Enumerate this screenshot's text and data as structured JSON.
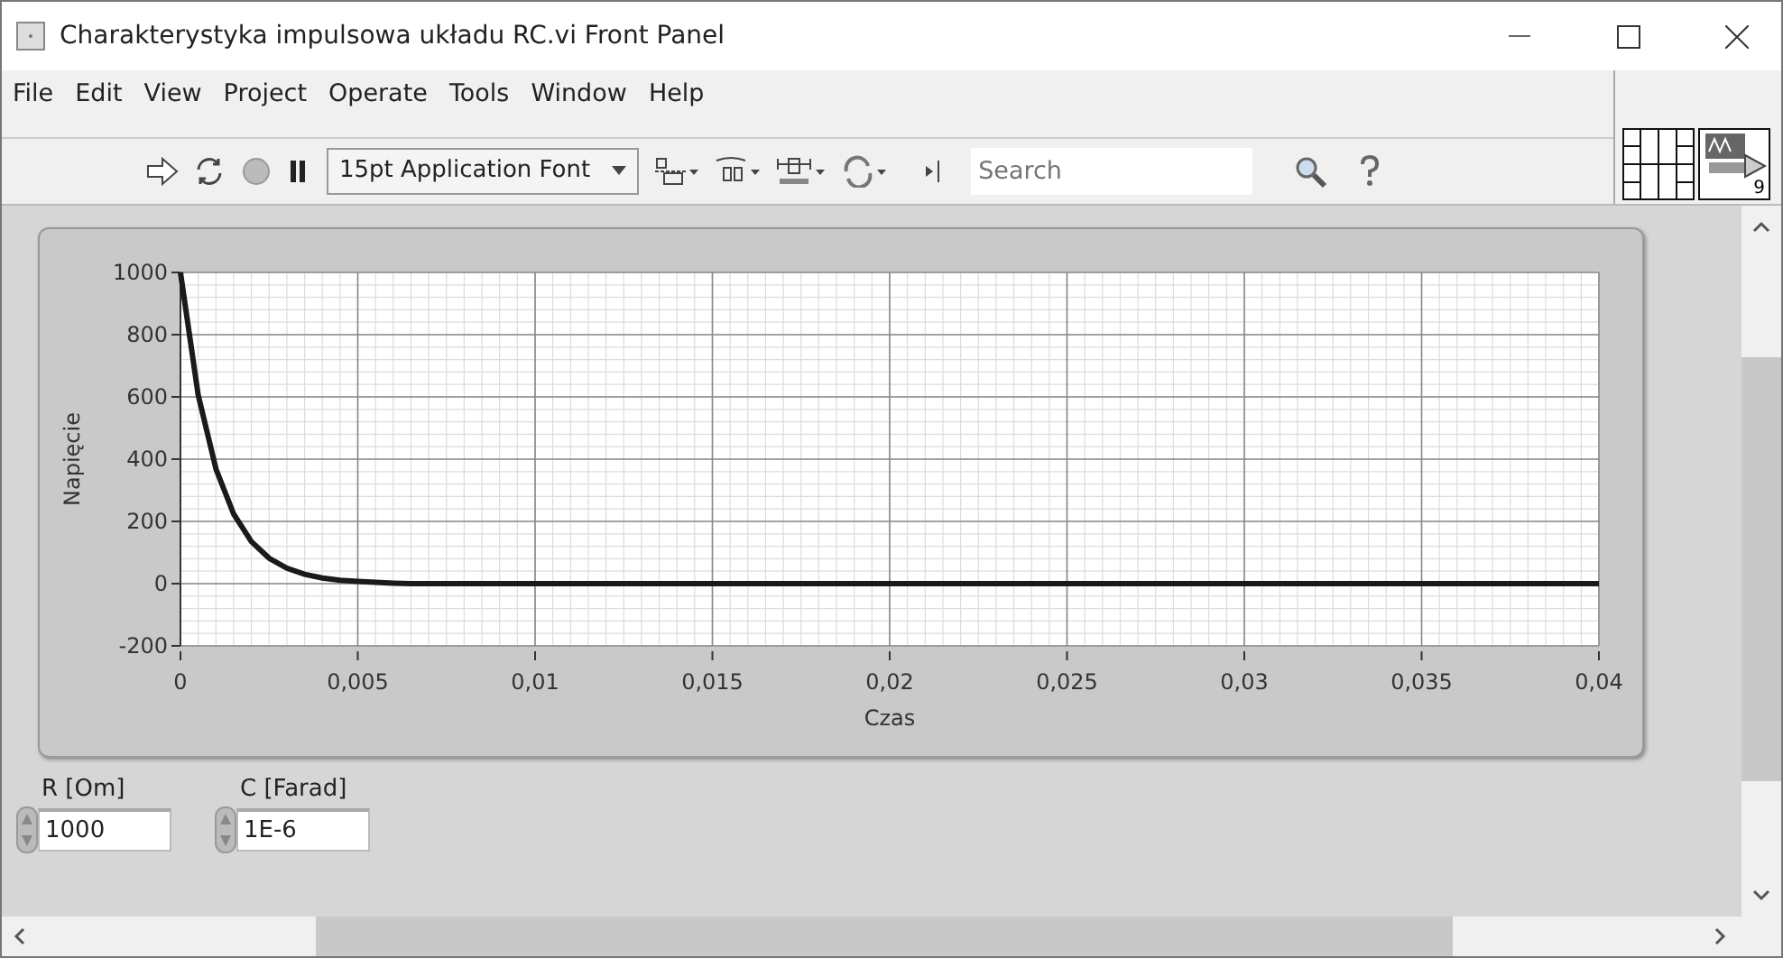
{
  "window": {
    "title": "Charakterystyka impulsowa układu RC.vi Front Panel"
  },
  "menu": [
    "File",
    "Edit",
    "View",
    "Project",
    "Operate",
    "Tools",
    "Window",
    "Help"
  ],
  "toolbar": {
    "font_dropdown": "15pt Application Font",
    "search": {
      "placeholder": "Search"
    },
    "vi_icon_label": "9"
  },
  "graph": {
    "chart_data": {
      "type": "line",
      "xlabel": "Czas",
      "ylabel": "Napięcie",
      "x": [
        0,
        0.0005,
        0.001,
        0.0015,
        0.002,
        0.0025,
        0.003,
        0.0035,
        0.004,
        0.0045,
        0.005,
        0.0055,
        0.006,
        0.0065,
        0.01,
        0.02,
        0.03,
        0.04
      ],
      "grid": true,
      "series": [
        {
          "color": "#1a1a1a",
          "values": [
            1000,
            607,
            368,
            223,
            135,
            82,
            50,
            30,
            18,
            11,
            7,
            4,
            2,
            0,
            0,
            0,
            0,
            0
          ]
        }
      ],
      "xlim": [
        0,
        0.04
      ],
      "ylim": [
        -200,
        1000
      ],
      "xticks": [
        0,
        {
          "value": 0.005,
          "label": "0,005"
        },
        {
          "value": 0.01,
          "label": "0,01"
        },
        {
          "value": 0.015,
          "label": "0,015"
        },
        {
          "value": 0.02,
          "label": "0,02"
        },
        {
          "value": 0.025,
          "label": "0,025"
        },
        {
          "value": 0.03,
          "label": "0,03"
        },
        {
          "value": 0.035,
          "label": "0,035"
        },
        {
          "value": 0.04,
          "label": "0,04"
        }
      ],
      "yticks": [
        -200,
        0,
        200,
        400,
        600,
        800,
        1000
      ]
    }
  },
  "controls": [
    {
      "label": "R [Om]",
      "value": "1000"
    },
    {
      "label": "C [Farad]",
      "value": "1E-6"
    }
  ]
}
